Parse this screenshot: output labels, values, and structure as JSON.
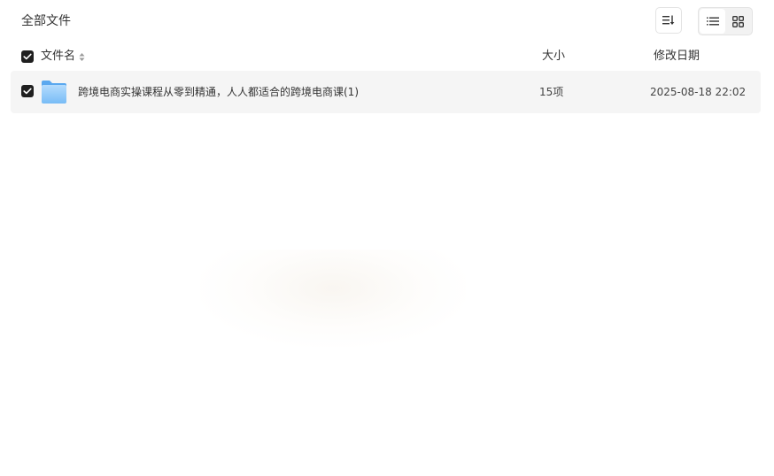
{
  "header": {
    "breadcrumb": "全部文件",
    "sort_icon": "sort-list-icon",
    "view_modes": [
      {
        "name": "list",
        "icon": "list-view-icon",
        "active": true
      },
      {
        "name": "grid",
        "icon": "grid-view-icon",
        "active": false
      }
    ]
  },
  "columns": {
    "name": "文件名",
    "size": "大小",
    "date": "修改日期"
  },
  "files": [
    {
      "name": "跨境电商实操课程从零到精通，人人都适合的跨境电商课(1)",
      "size": "15项",
      "date": "2025-08-18 22:02",
      "type": "folder",
      "checked": true
    }
  ],
  "colors": {
    "row_background": "#f5f5f5",
    "checkbox": "#1f1f1f",
    "folder_light": "#a8d4fb",
    "folder_dark": "#6cb4f5"
  }
}
